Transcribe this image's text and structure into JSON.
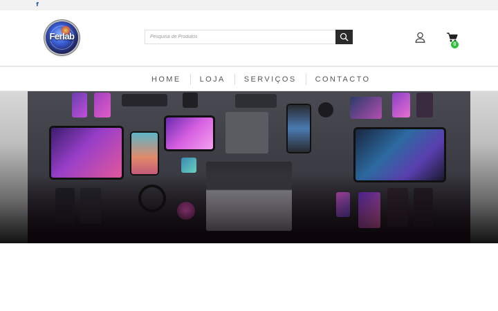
{
  "topbar": {
    "social": [
      {
        "icon": "facebook-icon",
        "glyph": "f"
      }
    ]
  },
  "header": {
    "logo_text": "Ferlab",
    "search": {
      "placeholder": "Pesquisa de Produtos",
      "value": ""
    },
    "cart": {
      "count": "0"
    }
  },
  "nav": {
    "items": [
      {
        "label": "HOME"
      },
      {
        "label": "LOJA"
      },
      {
        "label": "SERVIÇOS"
      },
      {
        "label": "CONTACTO"
      }
    ]
  },
  "hero": {
    "image": "electronic-devices-flat-lay"
  },
  "colors": {
    "accent": "#2b2b2b",
    "badge": "#2fbf3f",
    "facebook": "#1b4fa8"
  }
}
